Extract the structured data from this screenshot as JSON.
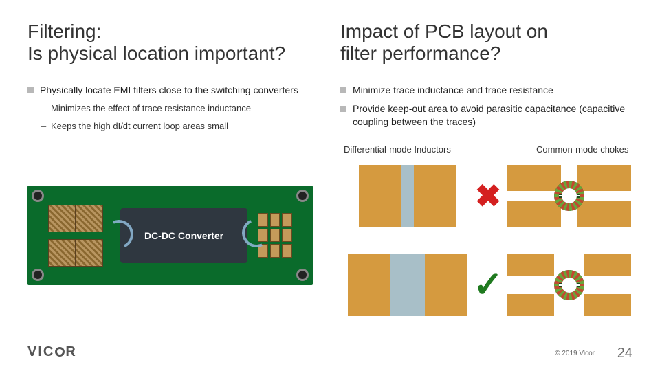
{
  "left": {
    "title_line1": "Filtering:",
    "title_line2": "Is physical location important?",
    "bullet1": "Physically locate EMI filters close to the switching converters",
    "sub1": "Minimizes the effect of trace resistance inductance",
    "sub2": "Keeps the high dI/dt current loop areas small",
    "dcdc_label": "DC-DC Converter"
  },
  "right": {
    "title_line1": "Impact of PCB layout on",
    "title_line2": "filter performance?",
    "bullet1": "Minimize trace inductance and trace resistance",
    "bullet2": "Provide keep-out area to avoid parasitic capacitance (capacitive coupling between the traces)",
    "subhead_dm": "Differential-mode Inductors",
    "subhead_cm": "Common-mode chokes",
    "bad_mark": "✖",
    "good_mark": "✓"
  },
  "footer": {
    "brand": "VICOR",
    "copyright": "© 2019 Vicor",
    "page": "24"
  }
}
